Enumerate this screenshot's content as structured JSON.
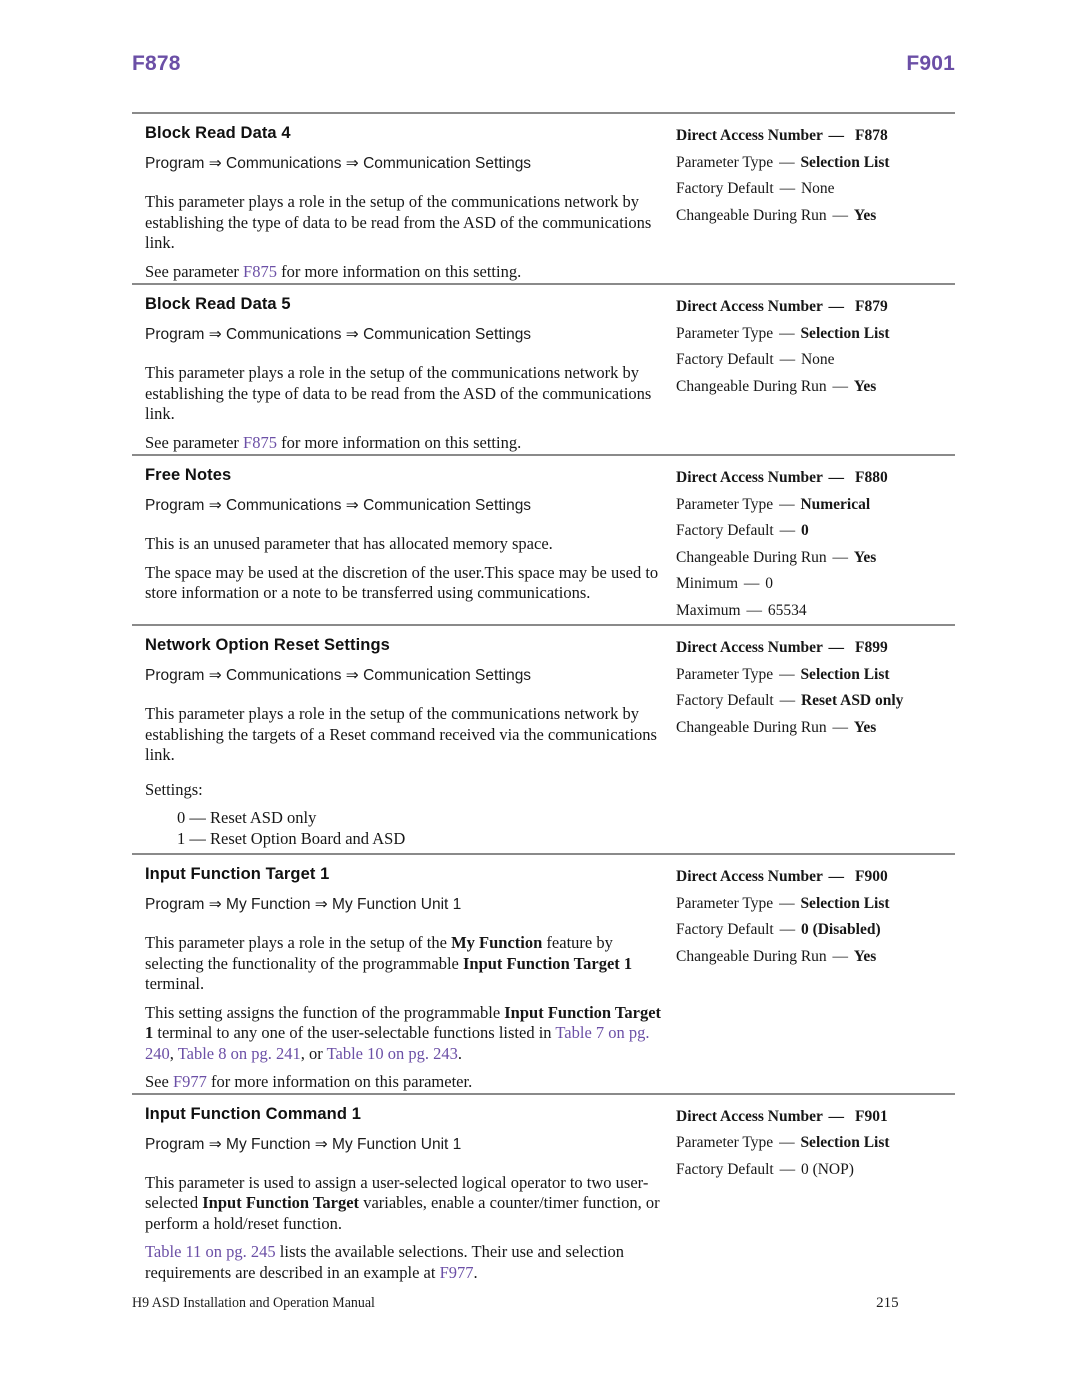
{
  "running_head": {
    "left": "F878",
    "right": "F901",
    "color": "#6b4fa6"
  },
  "footer": {
    "manual_title": "H9 ASD Installation and Operation Manual",
    "page_number": "215"
  },
  "spec_labels": {
    "direct_access_number": "Direct Access Number",
    "parameter_type": "Parameter Type",
    "factory_default": "Factory Default",
    "changeable_during_run": "Changeable During Run",
    "minimum": "Minimum",
    "maximum": "Maximum",
    "dash": "—"
  },
  "blocks": [
    {
      "title": "Block Read Data 4",
      "path": "Program ⇒ Communications ⇒ Communication Settings",
      "body_1_a": "This parameter plays a role in the setup of the communications network by establishing the type of data to be read from the ASD of the communications link.",
      "body_2_a": "See parameter ",
      "body_2_xref": "F875",
      "body_2_b": " for more information on this setting.",
      "specs": {
        "direct_access_number": "F878",
        "parameter_type": "Selection List",
        "factory_default": "None",
        "changeable_during_run": "Yes"
      }
    },
    {
      "title": "Block Read Data 5",
      "path": "Program ⇒ Communications ⇒ Communication Settings",
      "body_1_a": "This parameter plays a role in the setup of the communications network by establishing the type of data to be read from the ASD of the communications link.",
      "body_2_a": "See parameter ",
      "body_2_xref": "F875",
      "body_2_b": " for more information on this setting.",
      "specs": {
        "direct_access_number": "F879",
        "parameter_type": "Selection List",
        "factory_default": "None",
        "changeable_during_run": "Yes"
      }
    },
    {
      "title": "Free Notes",
      "path": "Program ⇒ Communications ⇒ Communication Settings",
      "body_1_a": "This is an unused parameter that has allocated memory space.",
      "body_2_a": "The space may be used at the discretion of the user.This space may be used to store information or a note to be transferred using communications.",
      "specs": {
        "direct_access_number": "F880",
        "parameter_type": "Numerical",
        "factory_default": "0",
        "changeable_during_run": "Yes",
        "minimum": "0",
        "maximum": "65534"
      }
    },
    {
      "title": "Network Option Reset Settings",
      "path": "Program ⇒ Communications ⇒ Communication Settings",
      "body_1_a": "This parameter plays a role in the setup of the communications network by establishing the targets of a Reset command received via the communications link.",
      "settings_label": "Settings:",
      "settings_items": [
        "0 — Reset ASD only",
        "1 — Reset Option Board and ASD"
      ],
      "specs": {
        "direct_access_number": "F899",
        "parameter_type": "Selection List",
        "factory_default": "Reset ASD only",
        "changeable_during_run": "Yes"
      }
    },
    {
      "title": "Input Function Target 1",
      "path": "Program ⇒ My Function ⇒ My Function Unit 1",
      "body_1_a": "This parameter plays a role in the setup of the ",
      "body_1_bold_1": "My Function",
      "body_1_b": " feature by selecting the functionality of the programmable ",
      "body_1_bold_2": "Input Function Target 1",
      "body_1_c": " terminal.",
      "body_2_a": "This setting assigns the function of the programmable ",
      "body_2_bold_1": "Input Function Target 1",
      "body_2_b": " terminal to any one of the user-selectable functions listed in ",
      "body_2_xref_1": "Table 7 on pg. 240",
      "body_2_c": ", ",
      "body_2_xref_2": "Table 8 on pg. 241",
      "body_2_d": ", or ",
      "body_2_xref_3": "Table 10 on pg. 243",
      "body_2_e": ".",
      "body_3_a": "See ",
      "body_3_xref": "F977",
      "body_3_b": " for more information on this parameter.",
      "specs": {
        "direct_access_number": "F900",
        "parameter_type": "Selection List",
        "factory_default": "0 (Disabled)",
        "changeable_during_run": "Yes"
      }
    },
    {
      "title": "Input Function Command 1",
      "path": "Program ⇒ My Function ⇒ My Function Unit 1",
      "body_1_a": "This parameter is used to assign a user-selected logical operator to two user-selected ",
      "body_1_bold_1": "Input Function Target",
      "body_1_b": " variables, enable a counter/timer function, or perform a hold/reset function.",
      "body_2_xref_1": "Table 11 on pg. 245",
      "body_2_a": " lists the available selections. Their use and selection requirements are described in an example at ",
      "body_2_xref_2": "F977",
      "body_2_b": ".",
      "specs": {
        "direct_access_number": "F901",
        "parameter_type": "Selection List",
        "factory_default": "0 (NOP)"
      }
    }
  ]
}
